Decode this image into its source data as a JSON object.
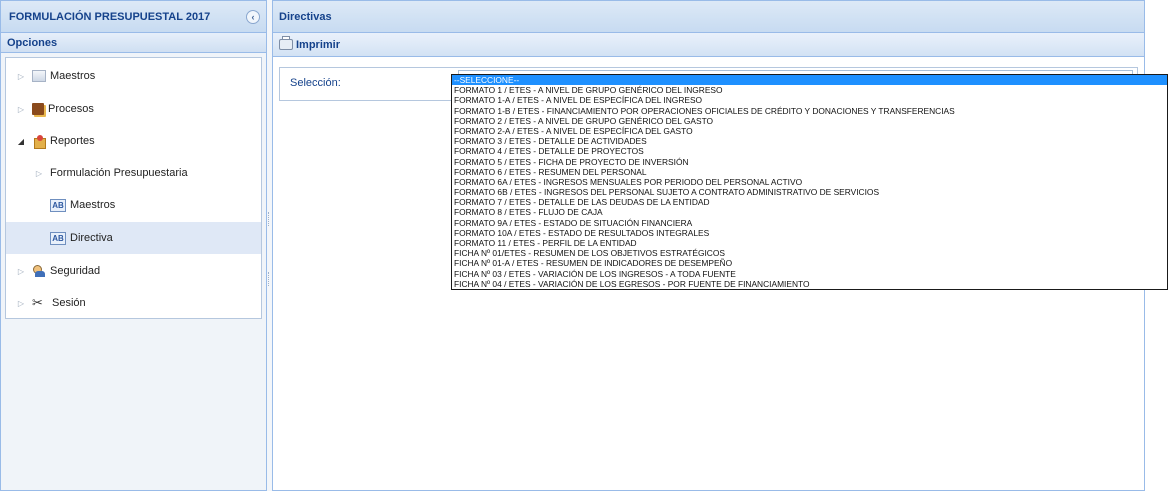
{
  "left_panel": {
    "title": "FORMULACIÓN PRESUPUESTAL 2017",
    "options_title": "Opciones",
    "collapse_glyph": "‹",
    "tree": [
      {
        "label": "Maestros",
        "icon": "folder-icon"
      },
      {
        "label": "Procesos",
        "icon": "book-icon"
      },
      {
        "label": "Reportes",
        "icon": "reports-icon"
      },
      {
        "label": "Formulación Presupuestaria",
        "icon": ""
      },
      {
        "label": "Maestros",
        "icon": "abc-report-icon"
      },
      {
        "label": "Directiva",
        "icon": "abc-report-icon"
      },
      {
        "label": "Seguridad",
        "icon": "users-icon"
      },
      {
        "label": "Sesión",
        "icon": "tools-icon"
      }
    ]
  },
  "right_panel": {
    "title": "Directivas",
    "print_label": "Imprimir",
    "selection_label": "Selección:"
  },
  "dropdown": {
    "options": [
      "--SELECCIONE--",
      "FORMATO 1 / ETES - A NIVEL DE GRUPO GENÉRICO DEL INGRESO",
      "FORMATO 1-A / ETES - A NIVEL DE ESPECÍFICA DEL INGRESO",
      "FORMATO 1-B / ETES - FINANCIAMIENTO POR OPERACIONES OFICIALES DE CRÉDITO Y DONACIONES Y TRANSFERENCIAS",
      "FORMATO 2 / ETES - A NIVEL DE GRUPO GENÉRICO DEL GASTO",
      "FORMATO 2-A / ETES - A NIVEL DE ESPECÍFICA DEL GASTO",
      "FORMATO 3 / ETES - DETALLE DE ACTIVIDADES",
      "FORMATO 4 / ETES - DETALLE DE PROYECTOS",
      "FORMATO 5 / ETES - FICHA DE PROYECTO DE INVERSIÓN",
      "FORMATO 6 / ETES - RESUMEN DEL PERSONAL",
      "FORMATO 6A / ETES - INGRESOS MENSUALES POR PERIODO DEL PERSONAL ACTIVO",
      "FORMATO 6B / ETES - INGRESOS DEL PERSONAL SUJETO A CONTRATO ADMINISTRATIVO DE SERVICIOS",
      "FORMATO 7 / ETES - DETALLE DE LAS DEUDAS DE LA ENTIDAD",
      "FORMATO 8 / ETES - FLUJO DE CAJA",
      "FORMATO 9A / ETES - ESTADO DE SITUACIÓN FINANCIERA",
      "FORMATO 10A / ETES - ESTADO DE RESULTADOS INTEGRALES",
      "FORMATO 11 / ETES - PERFIL DE LA ENTIDAD",
      "FICHA Nº 01/ETES - RESUMEN DE LOS OBJETIVOS ESTRATÉGICOS",
      "FICHA Nº 01-A / ETES - RESUMEN DE INDICADORES DE DESEMPEÑO",
      "FICHA Nº 03 / ETES - VARIACIÓN DE LOS INGRESOS - A TODA FUENTE",
      "FICHA Nº 04 / ETES - VARIACIÓN DE LOS EGRESOS - POR FUENTE DE FINANCIAMIENTO"
    ],
    "selected_index": 0
  },
  "colors": {
    "header_text": "#15428b",
    "border": "#99bbe8",
    "selection": "#1e90ff"
  }
}
